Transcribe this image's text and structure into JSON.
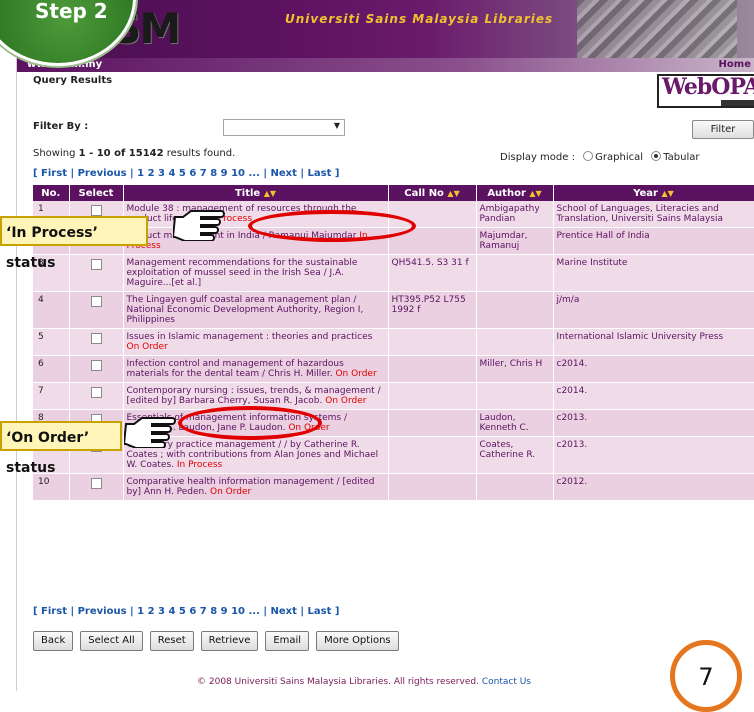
{
  "header": {
    "logo_text": "USM",
    "library_name": "Universiti Sains Malaysia Libraries",
    "url": "www.usm.my",
    "home": "Home",
    "page_title": "Query Results",
    "webopac_logo": "WebOPAC"
  },
  "filter": {
    "label": "Filter By :",
    "selected": "",
    "button": "Filter"
  },
  "summary": {
    "prefix": "Showing ",
    "range": "1 - 10 of 15142",
    "suffix": " results found."
  },
  "display_mode": {
    "label": "Display mode :",
    "options": [
      "Graphical",
      "Tabular"
    ],
    "selected": "Tabular"
  },
  "pager": {
    "text": "[ First | Previous | 1 2 3 4 5 6 7 8 9 10 ... | Next | Last ]"
  },
  "table": {
    "columns": [
      "No.",
      "Select",
      "Title",
      "Call No",
      "Author",
      "Year"
    ],
    "sort_glyph": "▲▼",
    "rows": [
      {
        "no": "1",
        "title": "Module 38 : management of resources through the product life cycle",
        "status": "In Process",
        "callno": "",
        "author": "Ambigapathy Pandian",
        "year": "School of Languages, Literacies and Translation, Universiti Sains Malaysia"
      },
      {
        "no": "2",
        "title": "Product management in India / Ramanuj Majumdar",
        "status": "In Process",
        "callno": "",
        "author": "Majumdar, Ramanuj",
        "year": "Prentice Hall of India"
      },
      {
        "no": "3",
        "title": "Management recommendations for the sustainable exploitation of mussel seed in the Irish Sea / J.A. Maguire...[et al.]",
        "status": "",
        "callno": "QH541.5. S3 31 f",
        "author": "",
        "year": "Marine Institute"
      },
      {
        "no": "4",
        "title": "The Lingayen gulf coastal area management plan / National Economic Development Authority, Region I, Philippines",
        "status": "",
        "callno": "HT395.P52 L755 1992 f",
        "author": "",
        "year": "j/m/a"
      },
      {
        "no": "5",
        "title": "Issues in Islamic management : theories and practices",
        "status": "On Order",
        "callno": "",
        "author": "",
        "year": "International Islamic University Press"
      },
      {
        "no": "6",
        "title": "Infection control and management of hazardous materials for the dental team / Chris H. Miller.",
        "status": "On Order",
        "callno": "",
        "author": "Miller, Chris H",
        "year": "c2014."
      },
      {
        "no": "7",
        "title": "Contemporary nursing : issues, trends, & management / [edited by] Barbara Cherry, Susan R. Jacob.",
        "status": "On Order",
        "callno": "",
        "author": "",
        "year": "c2014."
      },
      {
        "no": "8",
        "title": "Essentials of management information systems / Kenneth C. Laudon, Jane P. Laudon.",
        "status": "On Order",
        "callno": "",
        "author": "Laudon, Kenneth C.",
        "year": "c2013."
      },
      {
        "no": "9",
        "title": "Veterinary practice management / / by Catherine R. Coates ; with contributions from Alan Jones and Michael W. Coates.",
        "status": "In Process",
        "callno": "",
        "author": "Coates, Catherine R.",
        "year": "c2013."
      },
      {
        "no": "10",
        "title": "Comparative health information management / [edited by] Ann H. Peden.",
        "status": "On Order",
        "callno": "",
        "author": "",
        "year": "c2012."
      }
    ]
  },
  "buttons": [
    "Back",
    "Select All",
    "Reset",
    "Retrieve",
    "Email",
    "More Options"
  ],
  "footer": {
    "text": "© 2008 Universiti Sains Malaysia Libraries. All rights reserved.",
    "contact": "Contact Us"
  },
  "overlays": {
    "step_badge": "Step 2",
    "callout_in_process": "‘In Process’ status",
    "callout_on_order": "‘On Order’ status",
    "page_number": "7"
  },
  "colors": {
    "brand_purple": "#5b1260",
    "row_a": "#f0dce8",
    "row_b": "#ead0e0",
    "status_red": "#e00000",
    "accent_orange": "#e5761e"
  }
}
